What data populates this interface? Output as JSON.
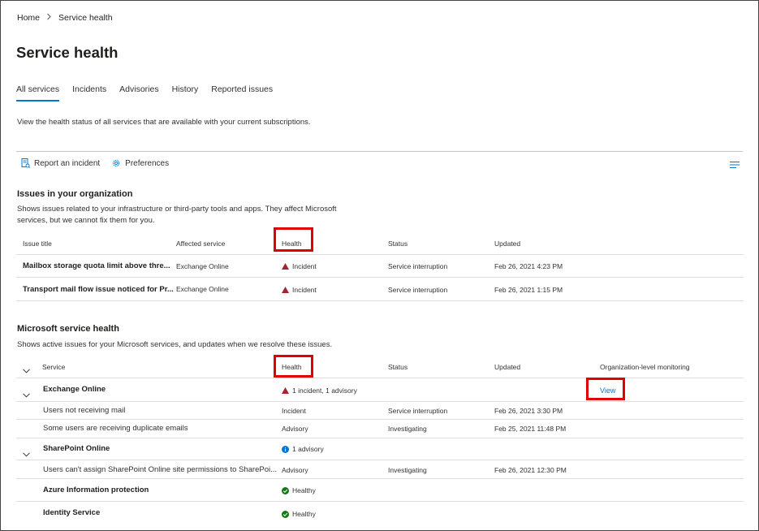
{
  "breadcrumb": {
    "home": "Home",
    "current": "Service health"
  },
  "page_title": "Service health",
  "tabs": [
    {
      "label": "All services",
      "active": true
    },
    {
      "label": "Incidents"
    },
    {
      "label": "Advisories"
    },
    {
      "label": "History"
    },
    {
      "label": "Reported issues"
    }
  ],
  "description": "View the health status of all services that are available with your current subscriptions.",
  "toolbar": {
    "report_label": "Report an incident",
    "preferences_label": "Preferences"
  },
  "org_issues": {
    "title": "Issues in your organization",
    "desc": "Shows issues related to your infrastructure or third-party tools and apps. They affect Microsoft services, but we cannot fix them for you.",
    "headers": {
      "title": "Issue title",
      "service": "Affected service",
      "health": "Health",
      "status": "Status",
      "updated": "Updated"
    },
    "rows": [
      {
        "title": "Mailbox storage quota limit above thre...",
        "service": "Exchange Online",
        "health": "Incident",
        "status": "Service interruption",
        "updated": "Feb 26, 2021 4:23 PM"
      },
      {
        "title": "Transport mail flow issue noticed for Pr...",
        "service": "Exchange Online",
        "health": "Incident",
        "status": "Service interruption",
        "updated": "Feb 26, 2021 1:15 PM"
      }
    ]
  },
  "ms_health": {
    "title": "Microsoft service health",
    "desc": "Shows active issues for your Microsoft services, and updates when we resolve these issues.",
    "headers": {
      "service": "Service",
      "health": "Health",
      "status": "Status",
      "updated": "Updated",
      "monitoring": "Organization-level monitoring"
    },
    "services": [
      {
        "name": "Exchange Online",
        "health": "1 incident, 1 advisory",
        "monitoring": "View",
        "issues": [
          {
            "title": "Users not receiving mail",
            "health": "Incident",
            "status": "Service interruption",
            "updated": "Feb 26, 2021 3:30 PM"
          },
          {
            "title": "Some users are receiving duplicate emails",
            "health": "Advisory",
            "status": "Investigating",
            "updated": "Feb 25, 2021 11:48 PM"
          }
        ]
      },
      {
        "name": "SharePoint Online",
        "health": "1 advisory",
        "issues": [
          {
            "title": "Users can't assign SharePoint Online site permissions to SharePoi...",
            "health": "Advisory",
            "status": "Investigating",
            "updated": "Feb 26, 2021 12:30 PM"
          }
        ]
      },
      {
        "name": "Azure Information protection",
        "health": "Healthy"
      },
      {
        "name": "Identity Service",
        "health": "Healthy"
      }
    ]
  },
  "colors": {
    "accent": "#0078d4",
    "incident": "#a4262c",
    "advisory": "#0078d4",
    "healthy": "#107c10",
    "highlight": "#e00000"
  },
  "icons": {
    "breadcrumb_sep": "chevron-right-icon",
    "report": "report-incident-icon",
    "preferences": "gear-icon",
    "list": "list-view-icon",
    "incident": "warning-triangle-icon",
    "advisory": "info-circle-icon",
    "healthy": "check-circle-icon",
    "expand": "chevron-down-icon"
  }
}
